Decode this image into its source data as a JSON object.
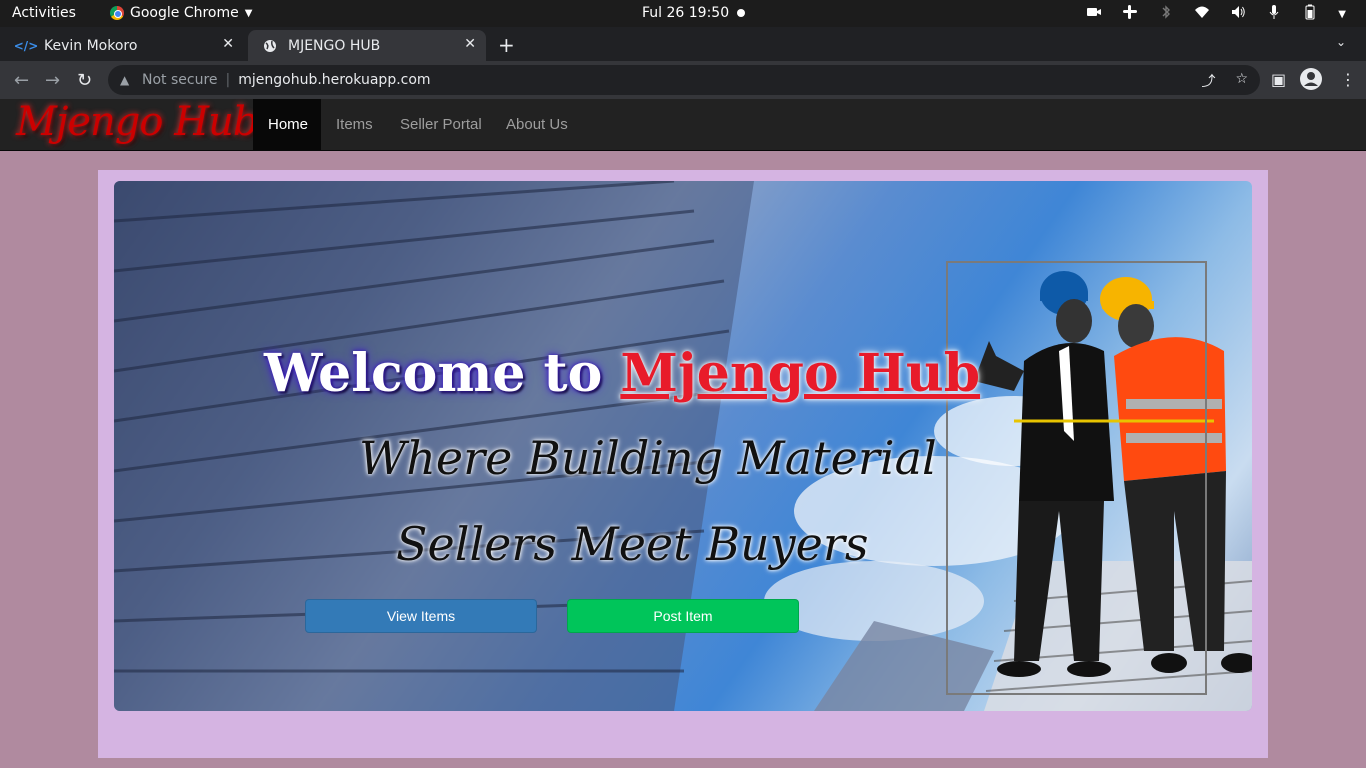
{
  "system_bar": {
    "activities": "Activities",
    "app_name": "Google Chrome",
    "clock": "Ful 26  19:50"
  },
  "tabs": [
    {
      "title": "Kevin Mokoro",
      "active": false
    },
    {
      "title": "MJENGO HUB",
      "active": true
    }
  ],
  "omnibox": {
    "security": "Not secure",
    "url": "mjengohub.herokuapp.com"
  },
  "site": {
    "logo": "Mjengo Hub",
    "nav": [
      {
        "label": "Home",
        "active": true
      },
      {
        "label": "Items",
        "active": false
      },
      {
        "label": "Seller Portal",
        "active": false
      },
      {
        "label": "About Us",
        "active": false
      }
    ]
  },
  "hero": {
    "title_prefix": "Welcome to ",
    "title_brand": "Mjengo Hub",
    "subtitle_line1": "Where Building Material",
    "subtitle_line2": "Sellers Meet Buyers",
    "view_button": "View Items",
    "post_button": "Post Item"
  },
  "colors": {
    "page_bg": "#b08a9f",
    "container_bg": "#d5b4e2",
    "navbar_bg": "#222222",
    "view_button": "#337ab7",
    "post_button": "#00c55a",
    "brand_red": "#e81b2a"
  }
}
